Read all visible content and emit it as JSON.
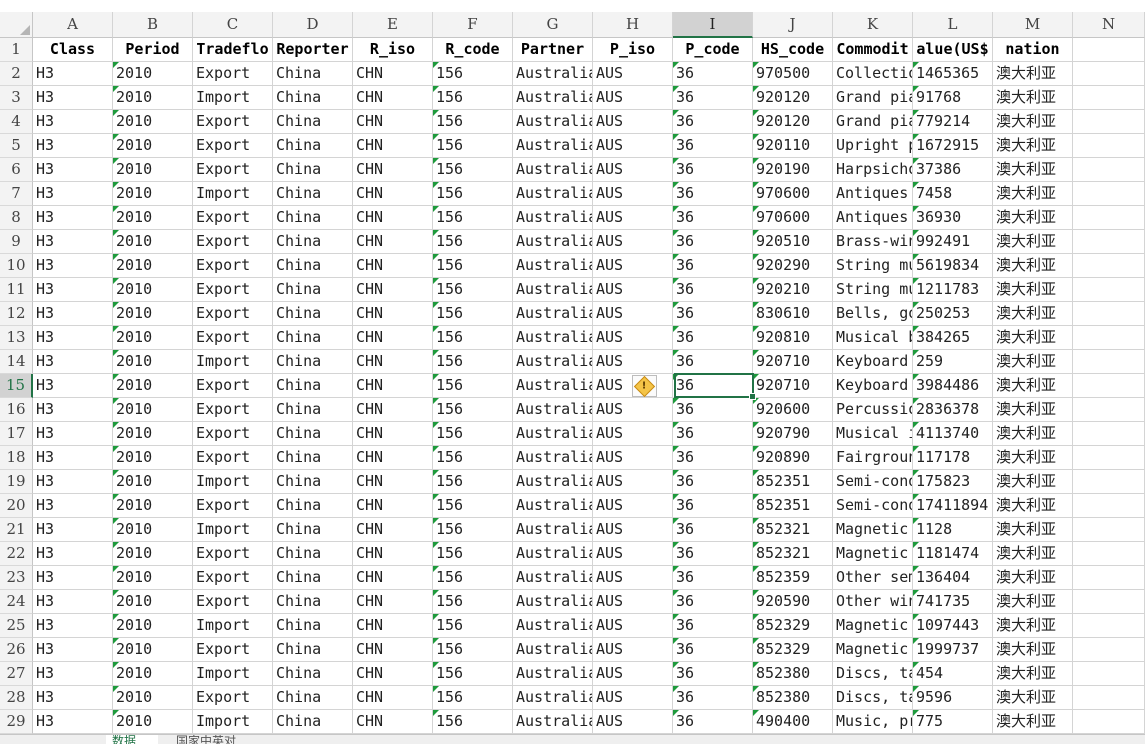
{
  "columns": [
    "A",
    "B",
    "C",
    "D",
    "E",
    "F",
    "G",
    "H",
    "I",
    "J",
    "K",
    "L",
    "M",
    "N"
  ],
  "header": [
    "Class",
    "Period",
    "Tradeflow",
    "Reporter",
    "R_iso",
    "R_code",
    "Partner",
    "P_iso",
    "P_code",
    "HS_code",
    "Commodity",
    "Value(US$)",
    "nation"
  ],
  "header_display": [
    "Class",
    "Period",
    "Tradeflo",
    "Reporter",
    "R_iso",
    "R_code",
    "Partner",
    "P_iso",
    "P_code",
    "HS_code",
    "Commodit",
    "alue(US$",
    "nation"
  ],
  "rows": [
    [
      "2",
      "H3",
      "2010",
      "Export",
      "China",
      "CHN",
      "156",
      "Australia",
      "AUS",
      "36",
      "970500",
      "Collectio",
      "1465365",
      "澳大利亚"
    ],
    [
      "3",
      "H3",
      "2010",
      "Import",
      "China",
      "CHN",
      "156",
      "Australia",
      "AUS",
      "36",
      "920120",
      "Grand pia",
      "91768",
      "澳大利亚"
    ],
    [
      "4",
      "H3",
      "2010",
      "Export",
      "China",
      "CHN",
      "156",
      "Australia",
      "AUS",
      "36",
      "920120",
      "Grand pia",
      "779214",
      "澳大利亚"
    ],
    [
      "5",
      "H3",
      "2010",
      "Export",
      "China",
      "CHN",
      "156",
      "Australia",
      "AUS",
      "36",
      "920110",
      "Upright p",
      "1672915",
      "澳大利亚"
    ],
    [
      "6",
      "H3",
      "2010",
      "Export",
      "China",
      "CHN",
      "156",
      "Australia",
      "AUS",
      "36",
      "920190",
      "Harpsicho",
      "37386",
      "澳大利亚"
    ],
    [
      "7",
      "H3",
      "2010",
      "Import",
      "China",
      "CHN",
      "156",
      "Australia",
      "AUS",
      "36",
      "970600",
      "Antiques",
      "7458",
      "澳大利亚"
    ],
    [
      "8",
      "H3",
      "2010",
      "Export",
      "China",
      "CHN",
      "156",
      "Australia",
      "AUS",
      "36",
      "970600",
      "Antiques",
      "36930",
      "澳大利亚"
    ],
    [
      "9",
      "H3",
      "2010",
      "Export",
      "China",
      "CHN",
      "156",
      "Australia",
      "AUS",
      "36",
      "920510",
      "Brass-win",
      "992491",
      "澳大利亚"
    ],
    [
      "10",
      "H3",
      "2010",
      "Export",
      "China",
      "CHN",
      "156",
      "Australia",
      "AUS",
      "36",
      "920290",
      "String mu",
      "5619834",
      "澳大利亚"
    ],
    [
      "11",
      "H3",
      "2010",
      "Export",
      "China",
      "CHN",
      "156",
      "Australia",
      "AUS",
      "36",
      "920210",
      "String mu",
      "1211783",
      "澳大利亚"
    ],
    [
      "12",
      "H3",
      "2010",
      "Export",
      "China",
      "CHN",
      "156",
      "Australia",
      "AUS",
      "36",
      "830610",
      "Bells, go",
      "250253",
      "澳大利亚"
    ],
    [
      "13",
      "H3",
      "2010",
      "Export",
      "China",
      "CHN",
      "156",
      "Australia",
      "AUS",
      "36",
      "920810",
      "Musical b",
      "384265",
      "澳大利亚"
    ],
    [
      "14",
      "H3",
      "2010",
      "Import",
      "China",
      "CHN",
      "156",
      "Australia",
      "AUS",
      "36",
      "920710",
      "Keyboard",
      "259",
      "澳大利亚"
    ],
    [
      "15",
      "H3",
      "2010",
      "Export",
      "China",
      "CHN",
      "156",
      "Australia",
      "AUS",
      "36",
      "920710",
      "Keyboard",
      "3984486",
      "澳大利亚"
    ],
    [
      "16",
      "H3",
      "2010",
      "Export",
      "China",
      "CHN",
      "156",
      "Australia",
      "AUS",
      "36",
      "920600",
      "Percussio",
      "2836378",
      "澳大利亚"
    ],
    [
      "17",
      "H3",
      "2010",
      "Export",
      "China",
      "CHN",
      "156",
      "Australia",
      "AUS",
      "36",
      "920790",
      "Musical i",
      "4113740",
      "澳大利亚"
    ],
    [
      "18",
      "H3",
      "2010",
      "Export",
      "China",
      "CHN",
      "156",
      "Australia",
      "AUS",
      "36",
      "920890",
      "Fairgroun",
      "117178",
      "澳大利亚"
    ],
    [
      "19",
      "H3",
      "2010",
      "Import",
      "China",
      "CHN",
      "156",
      "Australia",
      "AUS",
      "36",
      "852351",
      "Semi-cond",
      "175823",
      "澳大利亚"
    ],
    [
      "20",
      "H3",
      "2010",
      "Export",
      "China",
      "CHN",
      "156",
      "Australia",
      "AUS",
      "36",
      "852351",
      "Semi-cond",
      "17411894",
      "澳大利亚"
    ],
    [
      "21",
      "H3",
      "2010",
      "Import",
      "China",
      "CHN",
      "156",
      "Australia",
      "AUS",
      "36",
      "852321",
      "Magnetic",
      "1128",
      "澳大利亚"
    ],
    [
      "22",
      "H3",
      "2010",
      "Export",
      "China",
      "CHN",
      "156",
      "Australia",
      "AUS",
      "36",
      "852321",
      "Magnetic",
      "1181474",
      "澳大利亚"
    ],
    [
      "23",
      "H3",
      "2010",
      "Export",
      "China",
      "CHN",
      "156",
      "Australia",
      "AUS",
      "36",
      "852359",
      "Other sem",
      "136404",
      "澳大利亚"
    ],
    [
      "24",
      "H3",
      "2010",
      "Export",
      "China",
      "CHN",
      "156",
      "Australia",
      "AUS",
      "36",
      "920590",
      "Other win",
      "741735",
      "澳大利亚"
    ],
    [
      "25",
      "H3",
      "2010",
      "Import",
      "China",
      "CHN",
      "156",
      "Australia",
      "AUS",
      "36",
      "852329",
      "Magnetic",
      "1097443",
      "澳大利亚"
    ],
    [
      "26",
      "H3",
      "2010",
      "Export",
      "China",
      "CHN",
      "156",
      "Australia",
      "AUS",
      "36",
      "852329",
      "Magnetic",
      "1999737",
      "澳大利亚"
    ],
    [
      "27",
      "H3",
      "2010",
      "Import",
      "China",
      "CHN",
      "156",
      "Australia",
      "AUS",
      "36",
      "852380",
      "Discs, ta",
      "454",
      "澳大利亚"
    ],
    [
      "28",
      "H3",
      "2010",
      "Export",
      "China",
      "CHN",
      "156",
      "Australia",
      "AUS",
      "36",
      "852380",
      "Discs, ta",
      "9596",
      "澳大利亚"
    ],
    [
      "29",
      "H3",
      "2010",
      "Import",
      "China",
      "CHN",
      "156",
      "Australia",
      "AUS",
      "36",
      "490400",
      "Music, pr",
      "775",
      "澳大利亚"
    ]
  ],
  "selected": {
    "cell": "I15",
    "row": "15",
    "column": "I"
  },
  "sheet_tabs": [
    "数据",
    "国家中英对"
  ],
  "active_tab": 0,
  "error_indicator_icon": "warning-diamond-icon",
  "colors": {
    "accent": "#217346",
    "error_triangle": "#1e9a3c",
    "warning": "#f4c447"
  }
}
